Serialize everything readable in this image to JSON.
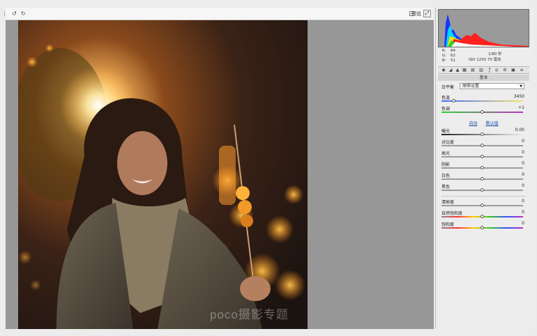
{
  "toolbar": {
    "icons": [
      "toggle-icon",
      "rotate-left-icon",
      "rotate-right-icon"
    ],
    "preview_label": "预览"
  },
  "canvas": {
    "background": "#979797",
    "watermark": "poco摄影专题"
  },
  "readout": {
    "r_label": "R:",
    "r_value": "84",
    "g_label": "G:",
    "g_value": "62",
    "b_label": "B:",
    "b_value": "51",
    "shutter": "1/80 秒",
    "iso_focal": "ISO 1250  70 毫米"
  },
  "panel": {
    "section_title": "基本",
    "white_balance": {
      "label": "白平衡",
      "value": "原照设置"
    },
    "temperature": {
      "label": "色温",
      "value": "3450",
      "level": 0.15
    },
    "tint": {
      "label": "色调",
      "value": "+1",
      "level": 0.5
    },
    "auto_label": "自动",
    "default_label": "默认值",
    "exposure": {
      "label": "曝光",
      "value": "0.00",
      "level": 0.5
    },
    "contrast": {
      "label": "对比度",
      "value": "0",
      "level": 0.5
    },
    "highlights": {
      "label": "高光",
      "value": "0",
      "level": 0.5
    },
    "shadows": {
      "label": "阴影",
      "value": "0",
      "level": 0.5
    },
    "whites": {
      "label": "白色",
      "value": "0",
      "level": 0.5
    },
    "blacks": {
      "label": "黑色",
      "value": "0",
      "level": 0.5
    },
    "clarity": {
      "label": "清晰度",
      "value": "0",
      "level": 0.5
    },
    "vibrance": {
      "label": "自然饱和度",
      "value": "0",
      "level": 0.5
    },
    "saturation": {
      "label": "饱和度",
      "value": "0",
      "level": 0.5
    }
  }
}
